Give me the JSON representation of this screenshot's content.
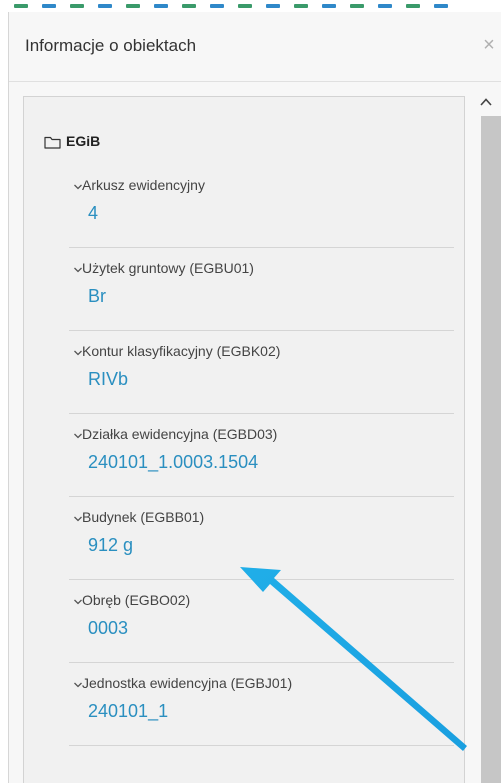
{
  "panel": {
    "title": "Informacje o obiektach",
    "close_glyph": "×"
  },
  "tree": {
    "root_label": "EGiB",
    "root_icon": "folder-icon",
    "items": [
      {
        "label": "Arkusz ewidencyjny",
        "value": "4"
      },
      {
        "label": "Użytek gruntowy (EGBU01)",
        "value": "Br"
      },
      {
        "label": "Kontur klasyfikacyjny (EGBK02)",
        "value": "RIVb"
      },
      {
        "label": "Działka ewidencyjna (EGBD03)",
        "value": "240101_1.0003.1504"
      },
      {
        "label": "Budynek (EGBB01)",
        "value": "912 g"
      },
      {
        "label": "Obręb (EGBO02)",
        "value": "0003"
      },
      {
        "label": "Jednostka ewidencyjna (EGBJ01)",
        "value": "240101_1"
      }
    ]
  },
  "colors": {
    "value_text": "#2a8fc0",
    "annotation_arrow": "#1fa8e6",
    "panel_bg": "#f7f7f7"
  },
  "annotation": {
    "type": "arrow",
    "icon": "arrow-annotation",
    "points_to": "Budynek (EGBB01) value"
  }
}
